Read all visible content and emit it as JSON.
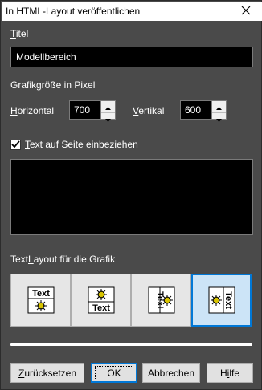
{
  "window": {
    "title": "In HTML-Layout veröffentlichen"
  },
  "titel": {
    "label_underlined": "T",
    "label_rest": "itel",
    "value": "Modellbereich"
  },
  "graphic_size": {
    "heading": "Grafikgröße in Pixel",
    "horizontal": {
      "label_underlined": "H",
      "label_rest": "orizontal",
      "value": "700"
    },
    "vertical": {
      "label_underlined": "V",
      "label_rest": "ertikal",
      "value": "600"
    }
  },
  "include_text": {
    "label_prefix": "",
    "label_underlined": "T",
    "label_rest": "ext auf Seite einbeziehen",
    "checked": true
  },
  "text_layout": {
    "label_prefix": "Text",
    "label_underlined": "L",
    "label_rest": "ayout für die Grafik",
    "options": [
      {
        "text": "Text",
        "position": "top",
        "selected": false
      },
      {
        "text": "Text",
        "position": "bottom",
        "selected": false
      },
      {
        "text": "Text",
        "position": "left",
        "selected": false
      },
      {
        "text": "Text",
        "position": "right",
        "selected": true
      }
    ]
  },
  "buttons": {
    "reset": {
      "underlined": "Z",
      "rest": "urücksetzen"
    },
    "ok": "OK",
    "cancel": "Abbrechen",
    "help": {
      "prefix": "H",
      "underlined": "i",
      "rest": "lfe"
    }
  },
  "colors": {
    "accent": "#0078d7",
    "background": "#4a4a4a",
    "field": "#000000"
  }
}
